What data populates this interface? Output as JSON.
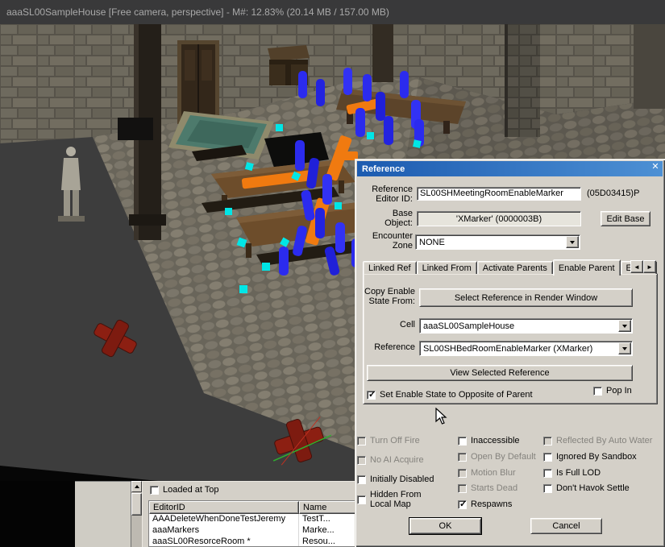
{
  "window": {
    "title": "aaaSL00SampleHouse [Free camera, perspective] - M#: 12.83% (20.14 MB / 157.00 MB)"
  },
  "dialog": {
    "title": "Reference",
    "close_icon": "✕",
    "editor_id": {
      "label": "Reference\nEditor ID:",
      "value": "SL00SHMeetingRoomEnableMarker",
      "form_id": "(05D03415)P"
    },
    "base_object": {
      "label": "Base\nObject:",
      "value": "'XMarker' (0000003B)",
      "edit_button": "Edit Base"
    },
    "encounter_zone": {
      "label": "Encounter\nZone",
      "value": "NONE"
    },
    "tabs": [
      {
        "label": "Linked Ref"
      },
      {
        "label": "Linked From"
      },
      {
        "label": "Activate Parents"
      },
      {
        "label": "Enable Parent"
      },
      {
        "label": "Emitta"
      }
    ],
    "tab_scroll_left": "◄",
    "tab_scroll_right": "►",
    "enable_parent": {
      "copy_label": "Copy Enable\nState From:",
      "select_button": "Select Reference in Render Window",
      "cell_label": "Cell",
      "cell_value": "aaaSL00SampleHouse",
      "reference_label": "Reference",
      "reference_value": "SL00SHBedRoomEnableMarker (XMarker)",
      "view_button": "View Selected Reference",
      "opposite": {
        "label": "Set Enable State to Opposite of Parent",
        "checked": true,
        "disabled": false
      },
      "pop_in": {
        "label": "Pop In",
        "checked": false,
        "disabled": false
      }
    },
    "flags": [
      {
        "label": "Turn Off Fire",
        "checked": false,
        "disabled": true
      },
      {
        "label": "No AI Acquire",
        "checked": false,
        "disabled": true
      },
      {
        "label": "Initially Disabled",
        "checked": false,
        "disabled": false
      },
      {
        "label": "Hidden From\nLocal Map",
        "checked": false,
        "disabled": false
      },
      {
        "label": "Inaccessible",
        "checked": false,
        "disabled": false
      },
      {
        "label": "Open By Default",
        "checked": false,
        "disabled": true
      },
      {
        "label": "Motion Blur",
        "checked": false,
        "disabled": true
      },
      {
        "label": "Starts Dead",
        "checked": false,
        "disabled": true
      },
      {
        "label": "Respawns",
        "checked": true,
        "disabled": false
      },
      {
        "label": "Reflected By Auto Water",
        "checked": false,
        "disabled": true
      },
      {
        "label": "Ignored By Sandbox",
        "checked": false,
        "disabled": false
      },
      {
        "label": "Is Full LOD",
        "checked": false,
        "disabled": false
      },
      {
        "label": "Don't Havok Settle",
        "checked": false,
        "disabled": false
      }
    ],
    "ok_button": "OK",
    "cancel_button": "Cancel"
  },
  "cell_view": {
    "loaded_at_top": "Loaded at Top",
    "columns": [
      "EditorID",
      "Name"
    ],
    "rows": [
      {
        "editor_id": "AAADeleteWhenDoneTestJeremy",
        "name": "TestT..."
      },
      {
        "editor_id": "aaaMarkers",
        "name": "Marke..."
      },
      {
        "editor_id": "aaaSL00ResorceRoom *",
        "name": "Resou..."
      }
    ]
  }
}
